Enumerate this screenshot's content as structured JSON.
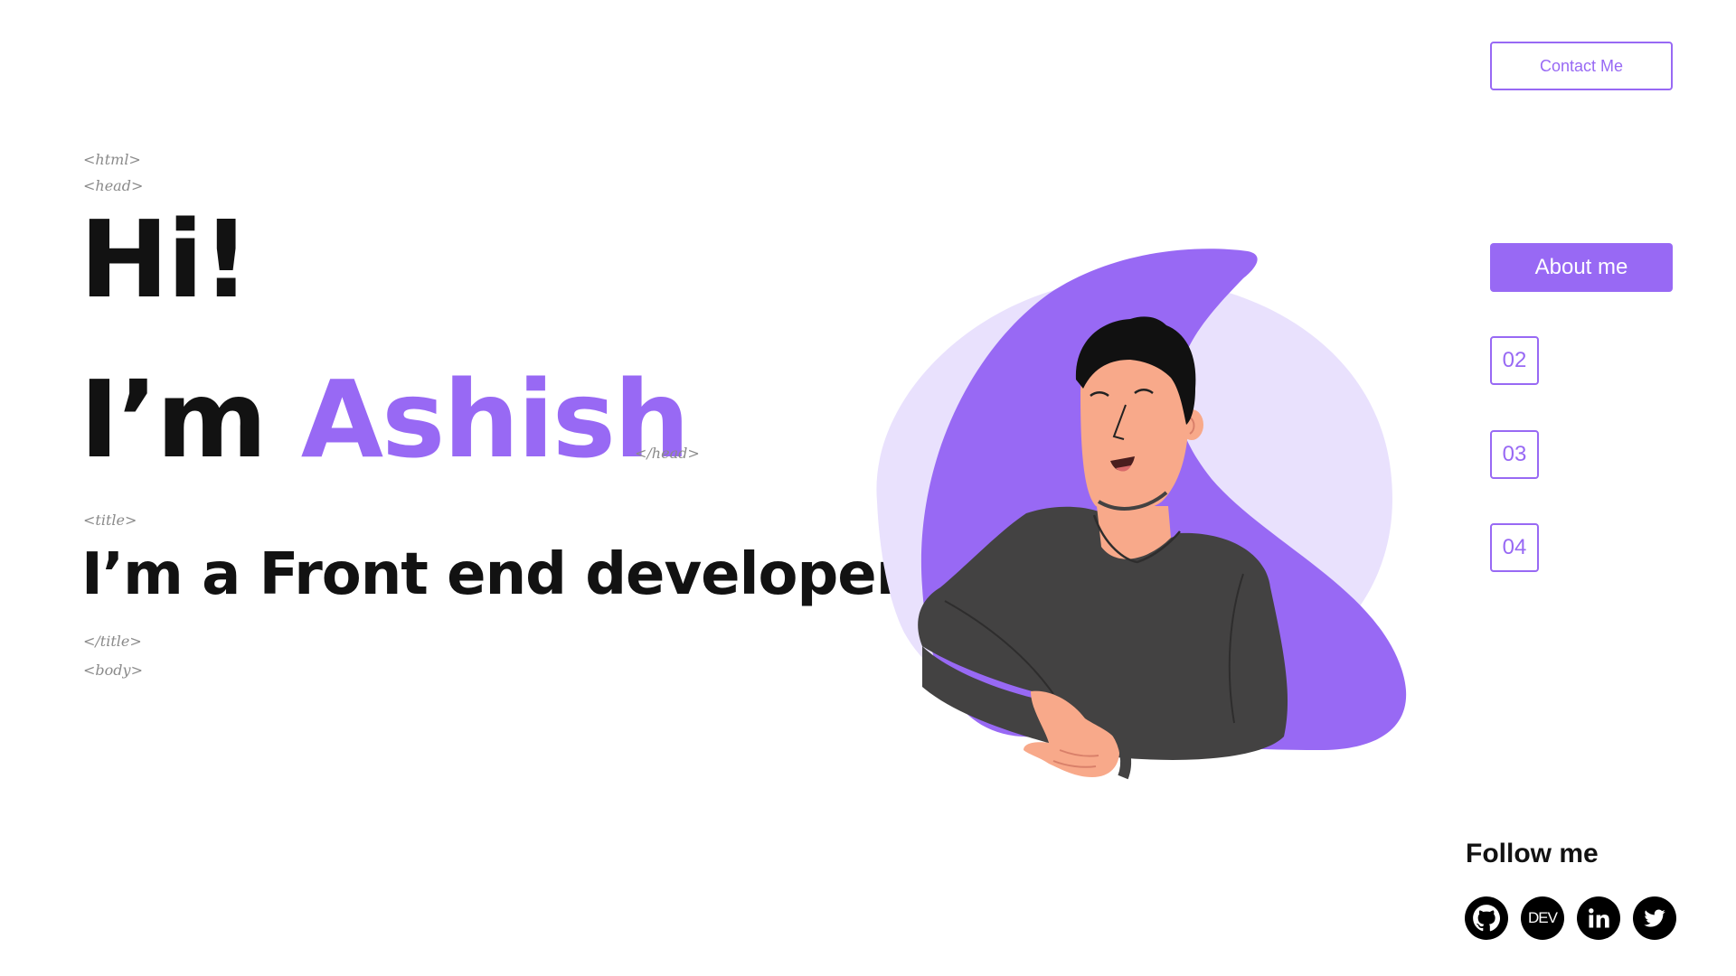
{
  "header": {
    "contact_label": "Contact Me"
  },
  "code_tags": {
    "html_open": "<html>",
    "head_open": "<head>",
    "head_close": "</head>",
    "title_open": "<title>",
    "title_close": "</title>",
    "body_open": "<body>"
  },
  "hero": {
    "greeting": "Hi!",
    "intro_prefix": "I’m ",
    "name": "Ashish",
    "role": "I’m a Front end developer"
  },
  "nav": {
    "items": [
      {
        "label": "About me",
        "active": true
      },
      {
        "label": "02",
        "active": false
      },
      {
        "label": "03",
        "active": false
      },
      {
        "label": "04",
        "active": false
      }
    ]
  },
  "follow": {
    "title": "Follow me",
    "socials": [
      {
        "name": "github",
        "icon": "github-icon"
      },
      {
        "name": "dev",
        "icon": "dev-icon",
        "text": "DEV"
      },
      {
        "name": "linkedin",
        "icon": "linkedin-icon",
        "text": "in"
      },
      {
        "name": "twitter",
        "icon": "twitter-icon"
      }
    ]
  },
  "colors": {
    "accent": "#9869f4",
    "accent_light": "#e9e1fd",
    "text": "#121212",
    "tag": "#8a8a8a"
  }
}
